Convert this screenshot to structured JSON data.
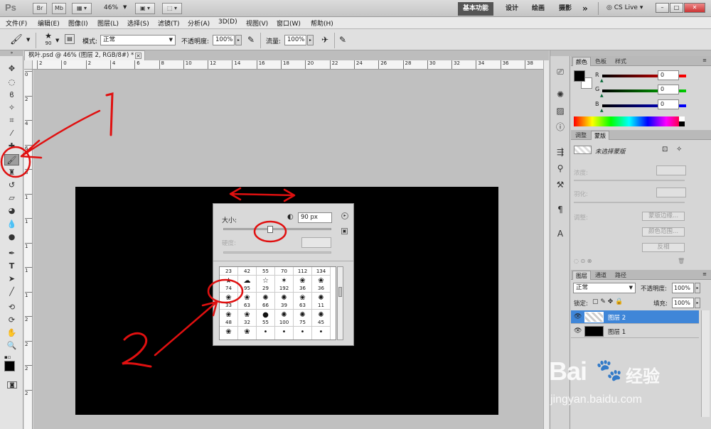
{
  "app": {
    "logo": "Ps",
    "zoom": "46%",
    "br_label": "Br",
    "mb_label": "Mb",
    "workspaces": [
      "基本功能",
      "设计",
      "绘画",
      "摄影"
    ],
    "more": "»",
    "cs_live": "CS Live"
  },
  "menu": [
    "文件(F)",
    "编辑(E)",
    "图像(I)",
    "图层(L)",
    "选择(S)",
    "滤镜(T)",
    "分析(A)",
    "3D(D)",
    "视图(V)",
    "窗口(W)",
    "帮助(H)"
  ],
  "options": {
    "brush_size": "90",
    "mode_label": "模式:",
    "mode_value": "正常",
    "opacity_label": "不透明度:",
    "opacity_value": "100%",
    "flow_label": "流量:",
    "flow_value": "100%"
  },
  "document": {
    "tab_title": "枫叶.psd @ 46% (图层 2, RGB/8#) *",
    "ruler_top": [
      "2",
      "0",
      "2",
      "4",
      "6",
      "8",
      "10",
      "12",
      "14",
      "16",
      "18",
      "20",
      "22",
      "24",
      "26",
      "28",
      "30",
      "32",
      "34",
      "36",
      "38"
    ],
    "ruler_left": [
      "0",
      "2",
      "4",
      "6",
      "8",
      "1",
      "1",
      "1",
      "1",
      "1",
      "2",
      "2",
      "2",
      "2"
    ],
    "canvas_color": "#000000"
  },
  "brush_popup": {
    "size_label": "大小:",
    "size_value": "90 px",
    "hardness_label": "硬度:",
    "rows": [
      [
        {
          "g": "•",
          "n": "23"
        },
        {
          "g": "•",
          "n": "42"
        },
        {
          "g": "•",
          "n": "55"
        },
        {
          "g": "•",
          "n": "70"
        },
        {
          "g": "/",
          "n": "112"
        },
        {
          "g": "\\",
          "n": "134"
        }
      ],
      [
        {
          "g": "★",
          "n": "74"
        },
        {
          "g": "☁",
          "n": "95"
        },
        {
          "g": "☆",
          "n": "29"
        },
        {
          "g": "✶",
          "n": "192"
        },
        {
          "g": "❀",
          "n": "36"
        },
        {
          "g": "❀",
          "n": "36"
        }
      ],
      [
        {
          "g": "❀",
          "n": "33"
        },
        {
          "g": "❀",
          "n": "63"
        },
        {
          "g": "✺",
          "n": "66"
        },
        {
          "g": "✺",
          "n": "39"
        },
        {
          "g": "❀",
          "n": "63"
        },
        {
          "g": "✺",
          "n": "11"
        }
      ],
      [
        {
          "g": "❀",
          "n": "48"
        },
        {
          "g": "❀",
          "n": "32"
        },
        {
          "g": "●",
          "n": "55"
        },
        {
          "g": "✺",
          "n": "100"
        },
        {
          "g": "✺",
          "n": "75"
        },
        {
          "g": "✺",
          "n": "45"
        }
      ],
      [
        {
          "g": "❀",
          "n": ""
        },
        {
          "g": "❀",
          "n": ""
        },
        {
          "g": "•",
          "n": ""
        },
        {
          "g": "•",
          "n": ""
        },
        {
          "g": "•",
          "n": ""
        },
        {
          "g": "•",
          "n": ""
        }
      ]
    ]
  },
  "color_panel": {
    "tabs": [
      "颜色",
      "色板",
      "样式"
    ],
    "channels": [
      {
        "label": "R",
        "value": "0"
      },
      {
        "label": "G",
        "value": "0"
      },
      {
        "label": "B",
        "value": "0"
      }
    ]
  },
  "adjust_panel": {
    "tabs": [
      "调整",
      "蒙版"
    ],
    "title": "未选择蒙版",
    "density_label": "浓度:",
    "feather_label": "羽化:",
    "refine_label": "调整:",
    "mask_edge_btn": "蒙版边缘...",
    "color_range_btn": "颜色范围...",
    "invert_btn": "反相"
  },
  "layers_panel": {
    "tabs": [
      "图层",
      "通道",
      "路径"
    ],
    "blend_mode": "正常",
    "opacity_label": "不透明度:",
    "opacity_value": "100%",
    "lock_label": "锁定:",
    "fill_label": "填充:",
    "fill_value": "100%",
    "layers": [
      {
        "name": "图层 2",
        "selected": true
      },
      {
        "name": "图层 1",
        "selected": false
      }
    ]
  },
  "annotations": {
    "one": "1",
    "two": "2"
  },
  "watermark": {
    "brand_left": "Bai",
    "brand_cn": "经验",
    "url": "jingyan.baidu.com"
  }
}
